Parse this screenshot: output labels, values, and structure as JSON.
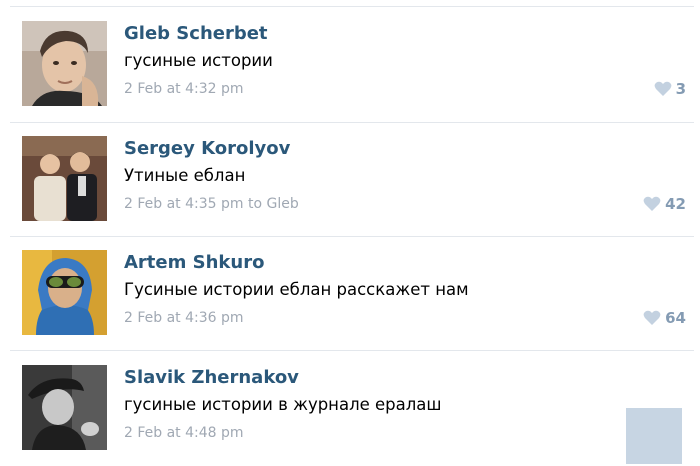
{
  "comments": [
    {
      "author": "Gleb Scherbet",
      "text": "гусиные истории",
      "meta": "2 Feb at 4:32 pm",
      "likes": "3",
      "avatar_icon": "person-photo"
    },
    {
      "author": "Sergey Korolyov",
      "text": "Утиные еблан",
      "meta": "2 Feb at 4:35 pm to Gleb",
      "likes": "42",
      "avatar_icon": "two-people-photo"
    },
    {
      "author": "Artem Shkuro",
      "text": "Гусиные истории еблан расскажет нам",
      "meta": "2 Feb at 4:36 pm",
      "likes": "64",
      "avatar_icon": "person-sunglasses-photo"
    },
    {
      "author": "Slavik Zhernakov",
      "text": "гусиные истории в журнале ералаш",
      "meta": "2 Feb at 4:48 pm",
      "likes": "",
      "avatar_icon": "person-hat-photo"
    }
  ],
  "colors": {
    "author": "#2b587a",
    "meta": "#a0a8b3",
    "like": "#849bb3",
    "divider": "#e3e7ec"
  }
}
